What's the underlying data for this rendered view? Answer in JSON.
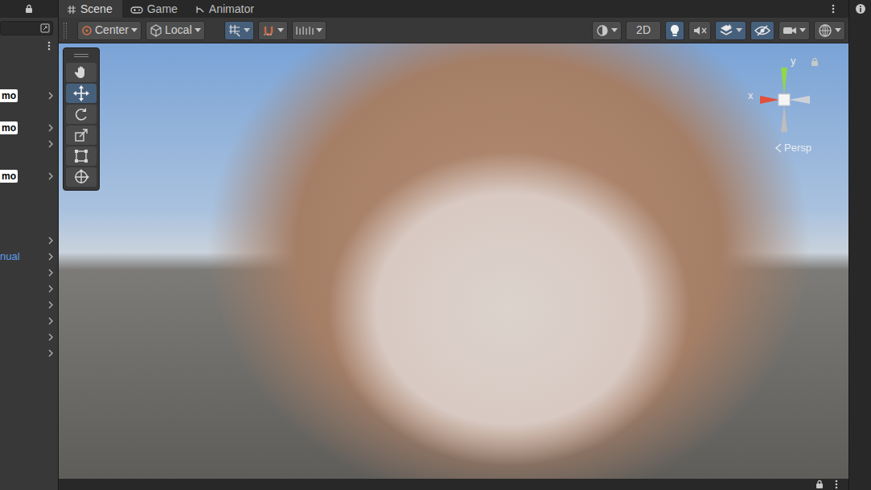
{
  "tabs": [
    {
      "label": "Scene",
      "selected": true,
      "kind": "scene"
    },
    {
      "label": "Game",
      "selected": false,
      "kind": "game"
    },
    {
      "label": "Animator",
      "selected": false,
      "kind": "animator"
    }
  ],
  "hierarchy": {
    "rows": [
      {
        "kind": "badge",
        "label": "mo",
        "expandable": true
      },
      {
        "kind": "empty",
        "expandable": false
      },
      {
        "kind": "badge",
        "label": "mo",
        "expandable": true
      },
      {
        "kind": "empty",
        "expandable": true
      },
      {
        "kind": "empty",
        "expandable": false
      },
      {
        "kind": "badge",
        "label": "mo",
        "expandable": true
      },
      {
        "kind": "empty",
        "expandable": false
      },
      {
        "kind": "empty",
        "expandable": false
      },
      {
        "kind": "empty",
        "expandable": false
      },
      {
        "kind": "empty",
        "expandable": true
      },
      {
        "kind": "link",
        "label": "nual",
        "expandable": true
      },
      {
        "kind": "empty",
        "expandable": true
      },
      {
        "kind": "empty",
        "expandable": true
      },
      {
        "kind": "empty",
        "expandable": true
      },
      {
        "kind": "empty",
        "expandable": true
      },
      {
        "kind": "empty",
        "expandable": true
      },
      {
        "kind": "empty",
        "expandable": true
      }
    ]
  },
  "toolbar": {
    "pivot": {
      "label": "Center"
    },
    "space": {
      "label": "Local"
    },
    "snapping": [
      {
        "kind": "grid",
        "selected": true
      },
      {
        "kind": "snap",
        "selected": false
      },
      {
        "kind": "increment",
        "selected": false
      }
    ],
    "view_options": [
      {
        "kind": "shading",
        "selected": false
      },
      {
        "kind": "mode2d",
        "label": "2D",
        "selected": false
      },
      {
        "kind": "light",
        "selected": true
      },
      {
        "kind": "audio",
        "selected": false
      },
      {
        "kind": "effects",
        "selected": true
      },
      {
        "kind": "hidden",
        "selected": true
      },
      {
        "kind": "camera",
        "selected": false
      },
      {
        "kind": "gizmos",
        "selected": false
      }
    ]
  },
  "tools": [
    {
      "kind": "hand",
      "selected": false
    },
    {
      "kind": "move",
      "selected": true
    },
    {
      "kind": "rotate",
      "selected": false
    },
    {
      "kind": "scale",
      "selected": false
    },
    {
      "kind": "rect",
      "selected": false
    },
    {
      "kind": "transform",
      "selected": false
    }
  ],
  "gizmo": {
    "y": "y",
    "x": "x",
    "projection": "Persp"
  }
}
